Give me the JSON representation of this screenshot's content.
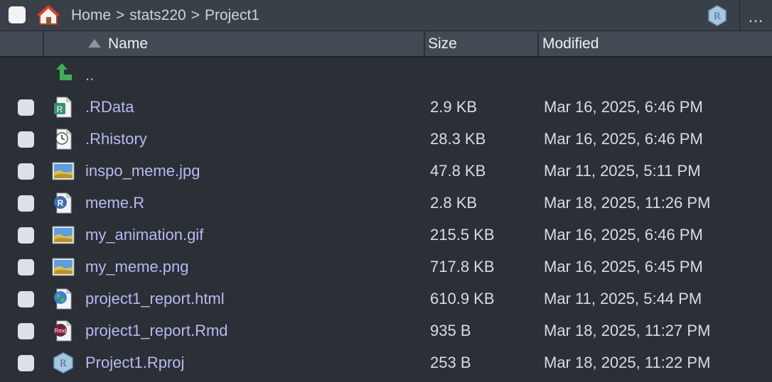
{
  "pathbar": {
    "crumbs": [
      "Home",
      "stats220",
      "Project1"
    ],
    "separator": ">",
    "more_label": "..."
  },
  "header": {
    "name": "Name",
    "size": "Size",
    "modified": "Modified"
  },
  "parent_dir": {
    "name": ".."
  },
  "files": [
    {
      "name": ".RData",
      "size": "2.9 KB",
      "modified": "Mar 16, 2025, 6:46 PM",
      "icon": "rdata-file-icon"
    },
    {
      "name": ".Rhistory",
      "size": "28.3 KB",
      "modified": "Mar 16, 2025, 6:46 PM",
      "icon": "history-file-icon"
    },
    {
      "name": "inspo_meme.jpg",
      "size": "47.8 KB",
      "modified": "Mar 11, 2025, 5:11 PM",
      "icon": "image-file-icon"
    },
    {
      "name": "meme.R",
      "size": "2.8 KB",
      "modified": "Mar 18, 2025, 11:26 PM",
      "icon": "r-script-icon"
    },
    {
      "name": "my_animation.gif",
      "size": "215.5 KB",
      "modified": "Mar 16, 2025, 6:46 PM",
      "icon": "image-file-icon"
    },
    {
      "name": "my_meme.png",
      "size": "717.8 KB",
      "modified": "Mar 16, 2025, 6:45 PM",
      "icon": "image-file-icon"
    },
    {
      "name": "project1_report.html",
      "size": "610.9 KB",
      "modified": "Mar 11, 2025, 5:44 PM",
      "icon": "html-file-icon"
    },
    {
      "name": "project1_report.Rmd",
      "size": "935 B",
      "modified": "Mar 18, 2025, 11:27 PM",
      "icon": "rmd-file-icon"
    },
    {
      "name": "Project1.Rproj",
      "size": "253 B",
      "modified": "Mar 18, 2025, 11:22 PM",
      "icon": "rproj-file-icon"
    }
  ],
  "icon_labels": {
    "r": "R",
    "rmd": "Rmd"
  },
  "colors": {
    "background": "#2b3036",
    "link": "#b9b8f2",
    "header": "#434a53"
  }
}
